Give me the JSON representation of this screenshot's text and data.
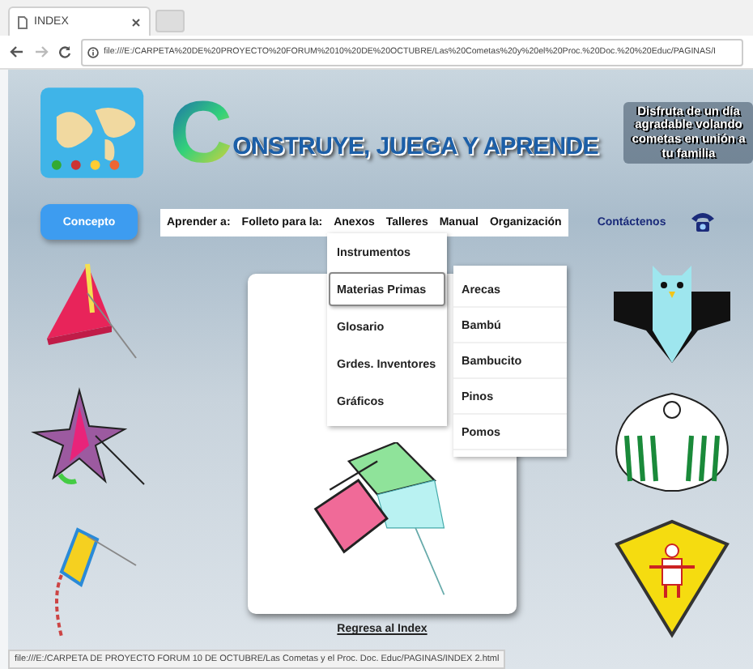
{
  "browser": {
    "tab_title": "INDEX",
    "address": "file:///E:/CARPETA%20DE%20PROYECTO%20FORUM%2010%20DE%20OCTUBRE/Las%20Cometas%20y%20el%20Proc.%20Doc.%20%20Educ/PAGINAS/I"
  },
  "header": {
    "title_initial": "C",
    "title_rest": "ONSTRUYE, JUEGA Y APRENDE",
    "tagline": "Disfruta de un día agradable volando cometas en unión a tu familia"
  },
  "concept_button": "Concepto",
  "nav": [
    "Aprender a:",
    "Folleto para la:",
    "Anexos",
    "Talleres",
    "Manual",
    "Organización"
  ],
  "dropdown": [
    {
      "label": "Instrumentos",
      "highlighted": false
    },
    {
      "label": "Materias Primas",
      "highlighted": true,
      "children": [
        "Arecas",
        "Bambú",
        "Bambucito",
        "Pinos",
        "Pomos"
      ]
    },
    {
      "label": "Glosario",
      "highlighted": false
    },
    {
      "label": "Grdes. Inventores",
      "highlighted": false
    },
    {
      "label": "Gráficos",
      "highlighted": false
    }
  ],
  "contact": "Contáctenos",
  "back_link": "Regresa al Index",
  "status_bar": "file:///E:/CARPETA DE PROYECTO FORUM 10 DE OCTUBRE/Las Cometas y el Proc. Doc.  Educ/PAGINAS/INDEX 2.html"
}
